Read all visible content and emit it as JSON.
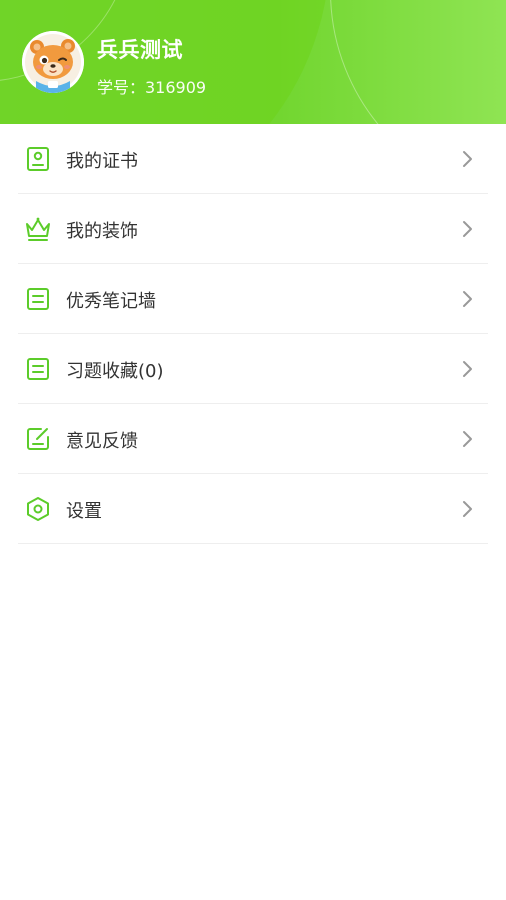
{
  "profile": {
    "name": "兵兵测试",
    "student_id": "学号：316909"
  },
  "menu": [
    {
      "label": "我的证书",
      "icon": "certificate-icon"
    },
    {
      "label": "我的装饰",
      "icon": "crown-icon"
    },
    {
      "label": "优秀笔记墙",
      "icon": "notes-icon"
    },
    {
      "label": "习题收藏(0)",
      "icon": "notes-icon"
    },
    {
      "label": "意见反馈",
      "icon": "feedback-icon"
    },
    {
      "label": "设置",
      "icon": "settings-hexagon-icon"
    }
  ],
  "colors": {
    "accent": "#5ccc2a",
    "header_start": "#74d63a",
    "header_end": "#8fe453",
    "chevron": "#999999"
  }
}
